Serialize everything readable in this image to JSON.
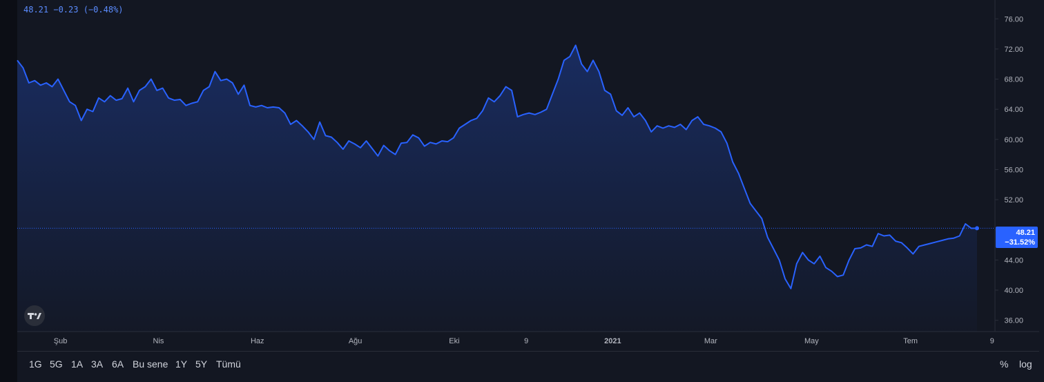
{
  "legend": {
    "last_price": "48.21",
    "change_abs": "−0.23",
    "change_pct": "(−0.48%)"
  },
  "price_tag": {
    "price": "48.21",
    "change": "−31.52%"
  },
  "toolbar": {
    "ranges": [
      "1G",
      "5G",
      "1A",
      "3A",
      "6A",
      "Bu sene",
      "1Y",
      "5Y",
      "Tümü"
    ],
    "percent_label": "%",
    "log_label": "log"
  },
  "colors": {
    "background": "#131722",
    "line": "#2962ff",
    "text": "#d1d4dc",
    "axis_text": "#b2b5be",
    "legend_text": "#5b8cff"
  },
  "chart_data": {
    "type": "area",
    "ylim": [
      34.5,
      78.5
    ],
    "y_ticks": [
      36,
      40,
      44,
      48,
      52,
      56,
      60,
      64,
      68,
      72,
      76
    ],
    "y_tick_labels": [
      "36.00",
      "40.00",
      "44.00",
      "48.00",
      "52.00",
      "56.00",
      "60.00",
      "64.00",
      "68.00",
      "72.00",
      "76.00"
    ],
    "x_tick_labels": [
      "Şub",
      "Nis",
      "Haz",
      "Ağu",
      "Eki",
      "9",
      "2021",
      "Mar",
      "May",
      "Tem",
      "9"
    ],
    "x_tick_bold": [
      false,
      false,
      false,
      false,
      false,
      false,
      true,
      false,
      false,
      false,
      false
    ],
    "x_tick_pos": [
      0.045,
      0.147,
      0.25,
      0.352,
      0.455,
      0.53,
      0.62,
      0.722,
      0.827,
      0.93,
      1.015
    ],
    "current_value": 48.21,
    "grid": false,
    "legend": "top-left",
    "series": [
      {
        "values": [
          70.5,
          69.5,
          67.5,
          67.8,
          67.2,
          67.5,
          67.0,
          68.0,
          66.5,
          65.0,
          64.5,
          62.5,
          64.0,
          63.7,
          65.5,
          65.0,
          65.8,
          65.2,
          65.4,
          66.8,
          65.0,
          66.5,
          67.0,
          68.0,
          66.5,
          66.8,
          65.5,
          65.2,
          65.3,
          64.5,
          64.8,
          65.0,
          66.5,
          67.0,
          69.0,
          67.8,
          68.0,
          67.5,
          66.0,
          67.2,
          64.5,
          64.3,
          64.5,
          64.2,
          64.3,
          64.2,
          63.5,
          62.0,
          62.5,
          61.8,
          61.0,
          60.0,
          62.3,
          60.5,
          60.3,
          59.6,
          58.7,
          59.8,
          59.4,
          58.9,
          59.8,
          58.8,
          57.8,
          59.2,
          58.5,
          58.0,
          59.5,
          59.6,
          60.6,
          60.2,
          59.1,
          59.6,
          59.4,
          59.8,
          59.7,
          60.2,
          61.5,
          62.0,
          62.5,
          62.8,
          63.8,
          65.5,
          65.0,
          65.8,
          67.0,
          66.5,
          63.0,
          63.3,
          63.5,
          63.3,
          63.6,
          64.0,
          66.0,
          68.0,
          70.5,
          71.0,
          72.5,
          70.0,
          69.0,
          70.5,
          69.0,
          66.5,
          66.0,
          63.8,
          63.2,
          64.2,
          63.0,
          63.5,
          62.5,
          61.0,
          61.8,
          61.5,
          61.8,
          61.6,
          62.0,
          61.3,
          62.5,
          63.0,
          62.0,
          61.8,
          61.5,
          61.0,
          59.5,
          57.0,
          55.5,
          53.5,
          51.5,
          50.5,
          49.5,
          47.0,
          45.5,
          44.0,
          41.5,
          40.2,
          43.5,
          45.0,
          44.0,
          43.5,
          44.5,
          43.0,
          42.5,
          41.8,
          42.0,
          44.0,
          45.5,
          45.6,
          46.0,
          45.8,
          47.5,
          47.2,
          47.3,
          46.5,
          46.3,
          45.6,
          44.8,
          45.8,
          46.0,
          46.2,
          46.4,
          46.6,
          46.8,
          46.9,
          47.2,
          48.8,
          48.2,
          48.21
        ]
      }
    ]
  }
}
